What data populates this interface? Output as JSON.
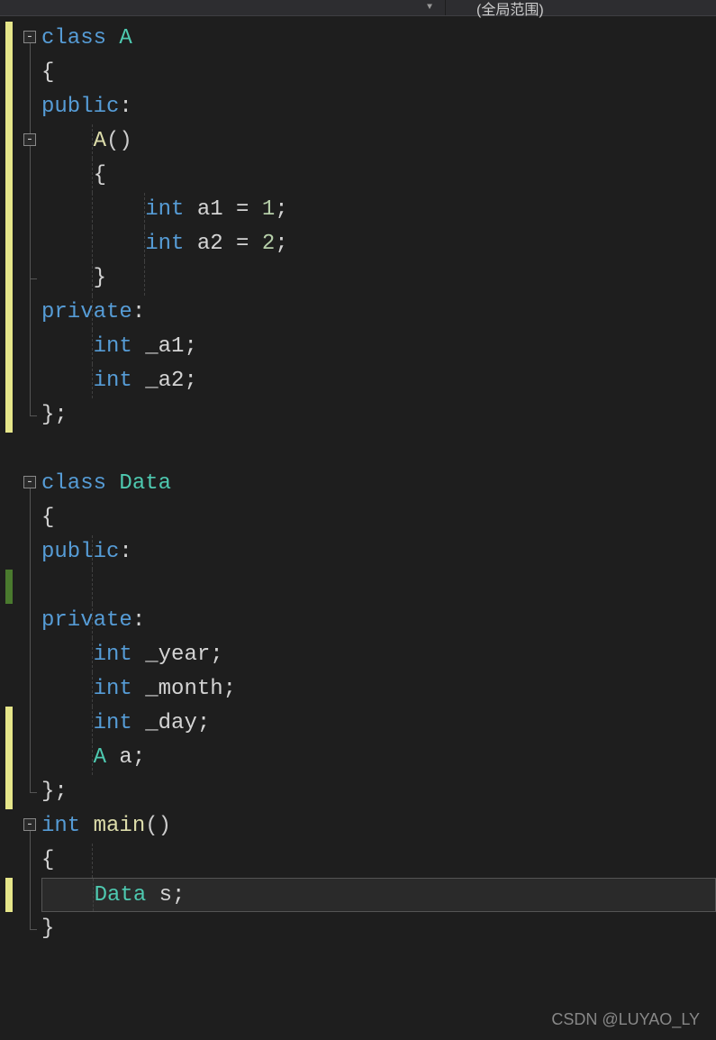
{
  "toolbar": {
    "scope_label": "(全局范围)"
  },
  "code": {
    "lines": [
      [
        {
          "t": "class ",
          "c": "kw"
        },
        {
          "t": "A",
          "c": "type"
        }
      ],
      [
        {
          "t": "{",
          "c": "punct"
        }
      ],
      [
        {
          "t": "public",
          "c": "kw"
        },
        {
          "t": ":",
          "c": "punct"
        }
      ],
      [
        {
          "t": "    ",
          "c": ""
        },
        {
          "t": "A",
          "c": "func"
        },
        {
          "t": "()",
          "c": "paren"
        }
      ],
      [
        {
          "t": "    {",
          "c": "punct"
        }
      ],
      [
        {
          "t": "        ",
          "c": ""
        },
        {
          "t": "int",
          "c": "kw"
        },
        {
          "t": " a1 ",
          "c": "ident"
        },
        {
          "t": "=",
          "c": "op"
        },
        {
          "t": " ",
          "c": ""
        },
        {
          "t": "1",
          "c": "num"
        },
        {
          "t": ";",
          "c": "semi"
        }
      ],
      [
        {
          "t": "        ",
          "c": ""
        },
        {
          "t": "int",
          "c": "kw"
        },
        {
          "t": " a2 ",
          "c": "ident"
        },
        {
          "t": "=",
          "c": "op"
        },
        {
          "t": " ",
          "c": ""
        },
        {
          "t": "2",
          "c": "num"
        },
        {
          "t": ";",
          "c": "semi"
        }
      ],
      [
        {
          "t": "    }",
          "c": "punct"
        }
      ],
      [
        {
          "t": "private",
          "c": "kw"
        },
        {
          "t": ":",
          "c": "punct"
        }
      ],
      [
        {
          "t": "    ",
          "c": ""
        },
        {
          "t": "int",
          "c": "kw"
        },
        {
          "t": " _a1;",
          "c": "ident"
        }
      ],
      [
        {
          "t": "    ",
          "c": ""
        },
        {
          "t": "int",
          "c": "kw"
        },
        {
          "t": " _a2;",
          "c": "ident"
        }
      ],
      [
        {
          "t": "};",
          "c": "punct"
        }
      ],
      [],
      [
        {
          "t": "class ",
          "c": "kw"
        },
        {
          "t": "Data",
          "c": "type"
        }
      ],
      [
        {
          "t": "{",
          "c": "punct"
        }
      ],
      [
        {
          "t": "public",
          "c": "kw"
        },
        {
          "t": ":",
          "c": "punct"
        }
      ],
      [],
      [
        {
          "t": "private",
          "c": "kw"
        },
        {
          "t": ":",
          "c": "punct"
        }
      ],
      [
        {
          "t": "    ",
          "c": ""
        },
        {
          "t": "int",
          "c": "kw"
        },
        {
          "t": " _year;",
          "c": "ident"
        }
      ],
      [
        {
          "t": "    ",
          "c": ""
        },
        {
          "t": "int",
          "c": "kw"
        },
        {
          "t": " _month;",
          "c": "ident"
        }
      ],
      [
        {
          "t": "    ",
          "c": ""
        },
        {
          "t": "int",
          "c": "kw"
        },
        {
          "t": " _day;",
          "c": "ident"
        }
      ],
      [
        {
          "t": "    ",
          "c": ""
        },
        {
          "t": "A",
          "c": "type"
        },
        {
          "t": " a;",
          "c": "ident"
        }
      ],
      [
        {
          "t": "};",
          "c": "punct"
        }
      ],
      [
        {
          "t": "int ",
          "c": "kw"
        },
        {
          "t": "main",
          "c": "func"
        },
        {
          "t": "()",
          "c": "paren"
        }
      ],
      [
        {
          "t": "{",
          "c": "punct"
        }
      ],
      [
        {
          "t": "    ",
          "c": ""
        },
        {
          "t": "Data",
          "c": "type"
        },
        {
          "t": " s;",
          "c": "ident"
        }
      ],
      [
        {
          "t": "}",
          "c": "punct"
        }
      ]
    ],
    "current_line_index": 25,
    "indent_guides": {
      "3": [
        56
      ],
      "4": [
        56
      ],
      "5": [
        56,
        114
      ],
      "6": [
        56,
        114
      ],
      "7": [
        56,
        114
      ],
      "8": [
        56
      ],
      "9": [
        56
      ],
      "10": [
        56
      ],
      "15": [
        56
      ],
      "16": [
        56
      ],
      "17": [
        56
      ],
      "18": [
        56
      ],
      "19": [
        56
      ],
      "20": [
        56
      ],
      "21": [
        56
      ],
      "24": [
        56
      ],
      "25": [
        56
      ]
    }
  },
  "gutter": {
    "line_height": 38,
    "top_pad": 6,
    "yellow_bars": [
      {
        "from": 0,
        "to": 11
      },
      {
        "from": 20,
        "to": 22
      },
      {
        "from": 25,
        "to": 25
      }
    ],
    "green_bars": [
      {
        "from": 16,
        "to": 16
      }
    ],
    "fold_boxes": [
      0,
      3,
      13,
      23
    ],
    "fold_regions": [
      {
        "from": 0,
        "to": 11
      },
      {
        "from": 3,
        "to": 7
      },
      {
        "from": 13,
        "to": 22
      },
      {
        "from": 23,
        "to": 26
      }
    ]
  },
  "watermark": "CSDN @LUYAO_LY"
}
